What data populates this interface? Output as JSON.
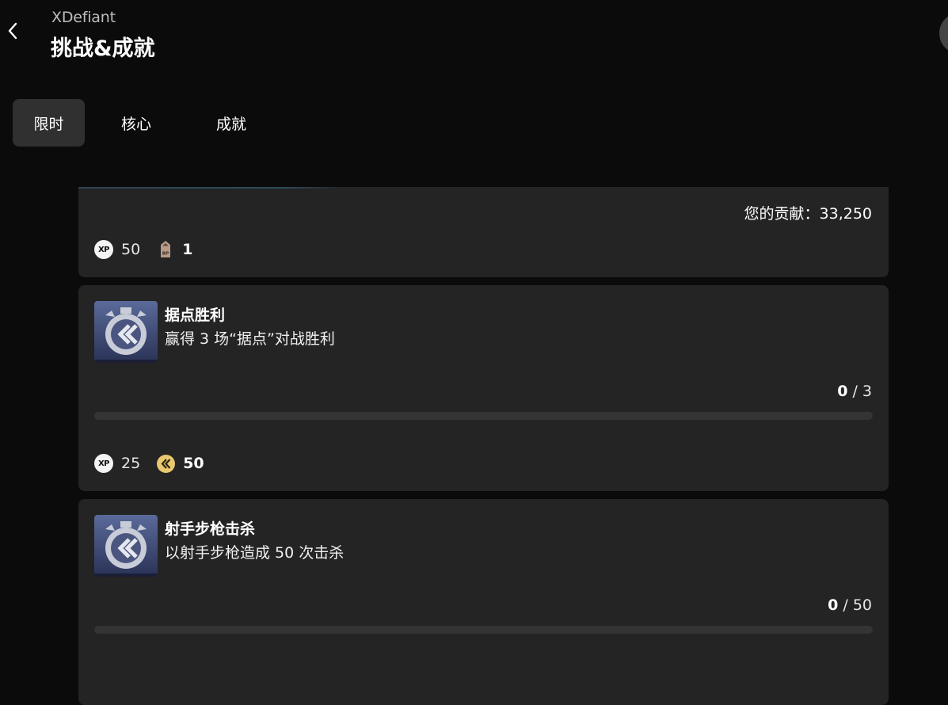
{
  "header": {
    "app_name": "XDefiant",
    "title": "挑战&成就",
    "back_icon": "chevron-left-icon"
  },
  "tabs": [
    {
      "label": "限时",
      "active": true
    },
    {
      "label": "核心",
      "active": false
    },
    {
      "label": "成就",
      "active": false
    }
  ],
  "partial_card": {
    "contribution": "您的贡献：33,250",
    "rewards": {
      "xp_icon": "xp-icon",
      "xp_value": "50",
      "bp_icon": "battle-pass-icon",
      "bp_value": "1"
    }
  },
  "challenges": [
    {
      "title": "据点胜利",
      "description": "赢得 3 场“据点”对战胜利",
      "progress_current": "0",
      "progress_total": "/ 3",
      "progress_fraction": 0,
      "icon": "challenge-timer-icon",
      "xp_value": "25",
      "coin_value": "50",
      "coin_icon": "xdefiant-coin-icon"
    },
    {
      "title": "射手步枪击杀",
      "description": "以射手步枪造成 50 次击杀",
      "progress_current": "0",
      "progress_total": "/ 50",
      "progress_fraction": 0,
      "icon": "challenge-timer-icon"
    }
  ],
  "colors": {
    "background": "#0b0b0b",
    "card": "#242424",
    "tab_active": "#303030",
    "coin": "#e9c870"
  }
}
